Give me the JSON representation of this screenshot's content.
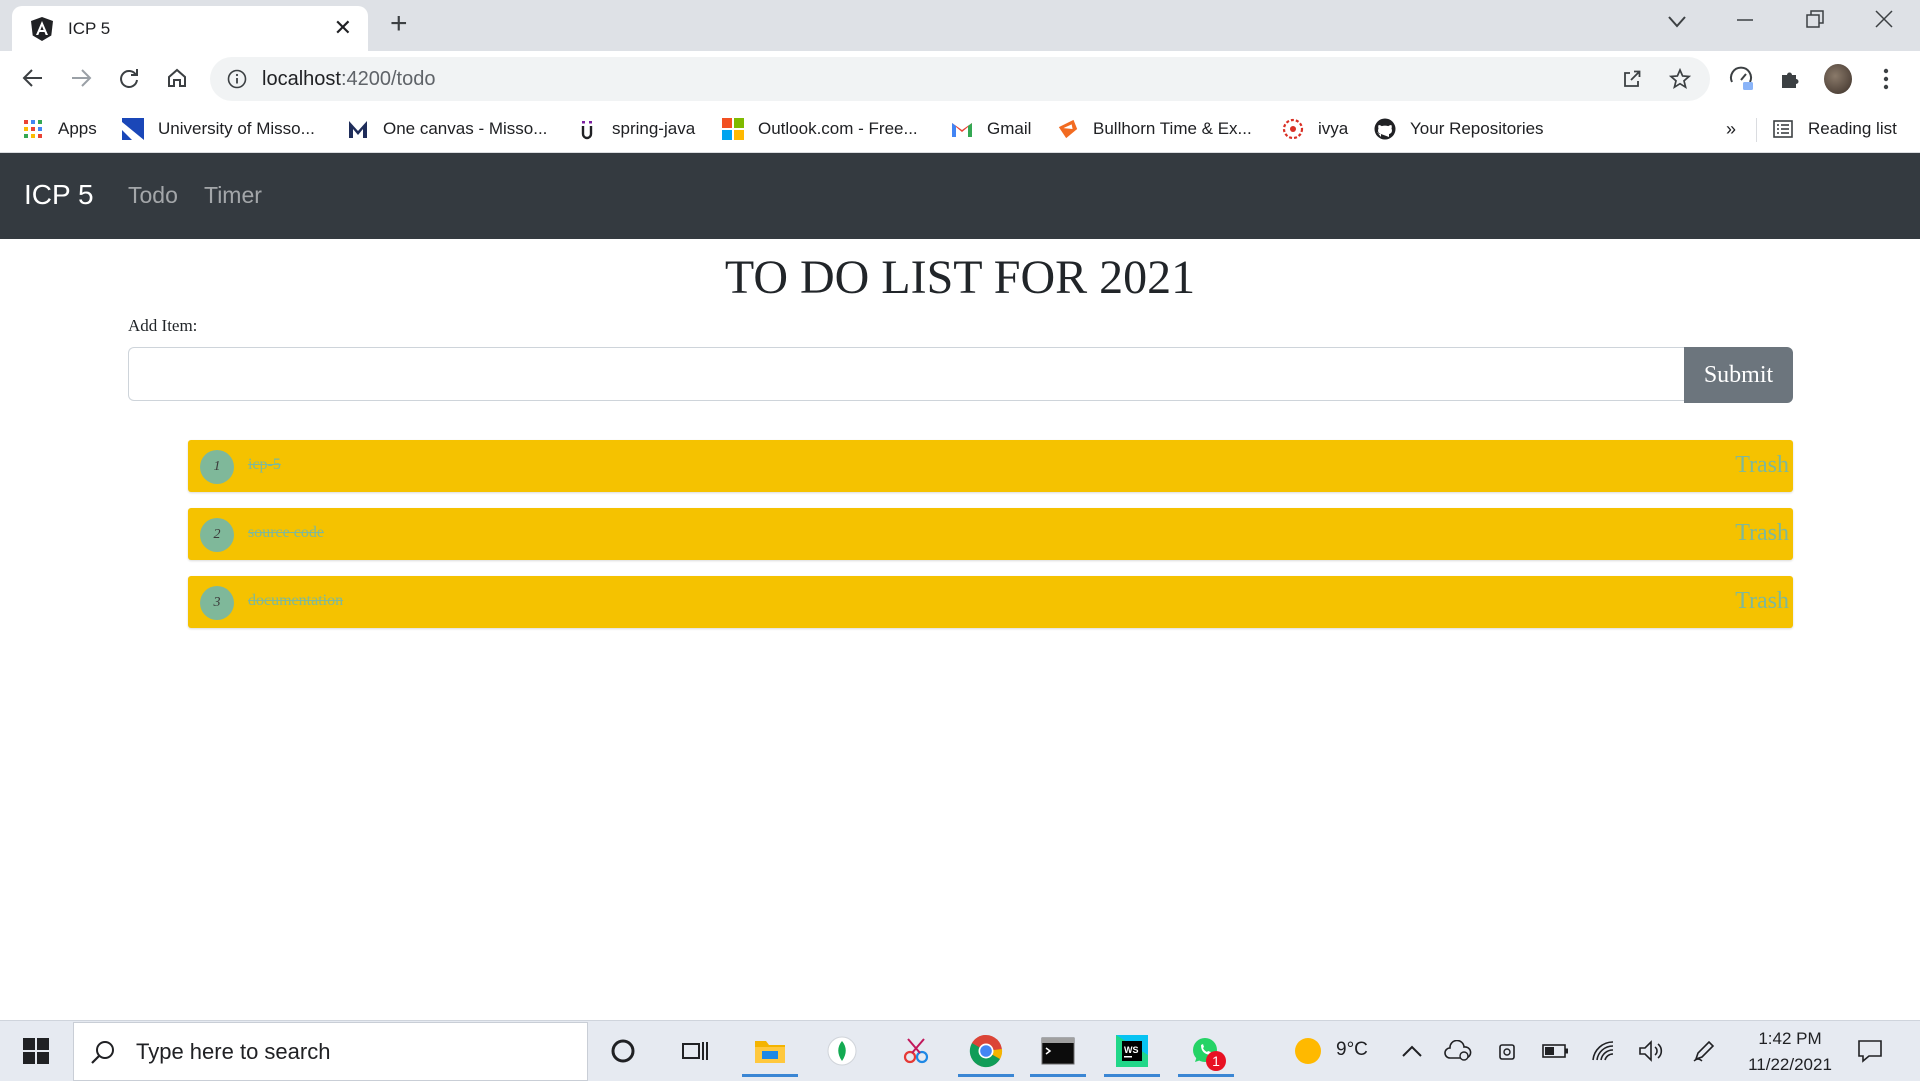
{
  "browser": {
    "tab_title": "ICP 5",
    "url_host": "localhost",
    "url_path": ":4200/todo",
    "bookmarks": [
      {
        "label": "Apps",
        "icon": "apps-grid-icon"
      },
      {
        "label": "University of Misso...",
        "icon": "university-icon"
      },
      {
        "label": "One canvas - Misso...",
        "icon": "canvas-icon"
      },
      {
        "label": "spring-java",
        "icon": "spring-icon"
      },
      {
        "label": "Outlook.com - Free...",
        "icon": "microsoft-icon"
      },
      {
        "label": "Gmail",
        "icon": "gmail-icon"
      },
      {
        "label": "Bullhorn Time & Ex...",
        "icon": "bullhorn-icon"
      },
      {
        "label": "ivya",
        "icon": "ivya-icon"
      },
      {
        "label": "Your Repositories",
        "icon": "github-icon"
      }
    ],
    "reading_list": "Reading list",
    "overflow": "»"
  },
  "app": {
    "brand": "ICP 5",
    "nav": [
      "Todo",
      "Timer"
    ],
    "title": "TO DO LIST FOR 2021",
    "add_label": "Add Item:",
    "input_value": "",
    "submit_label": "Submit",
    "items": [
      {
        "num": "1",
        "text": "icp-5",
        "trash": "Trash"
      },
      {
        "num": "2",
        "text": "source code",
        "trash": "Trash"
      },
      {
        "num": "3",
        "text": "documentation",
        "trash": "Trash"
      }
    ]
  },
  "taskbar": {
    "search_placeholder": "Type here to search",
    "temperature": "9°C",
    "time": "1:42 PM",
    "date": "11/22/2021",
    "whatsapp_badge": "1"
  },
  "colors": {
    "navbar": "#343a40",
    "item_bg": "#f5c200",
    "item_text": "#7fb89a",
    "submit_bg": "#6c757d"
  }
}
